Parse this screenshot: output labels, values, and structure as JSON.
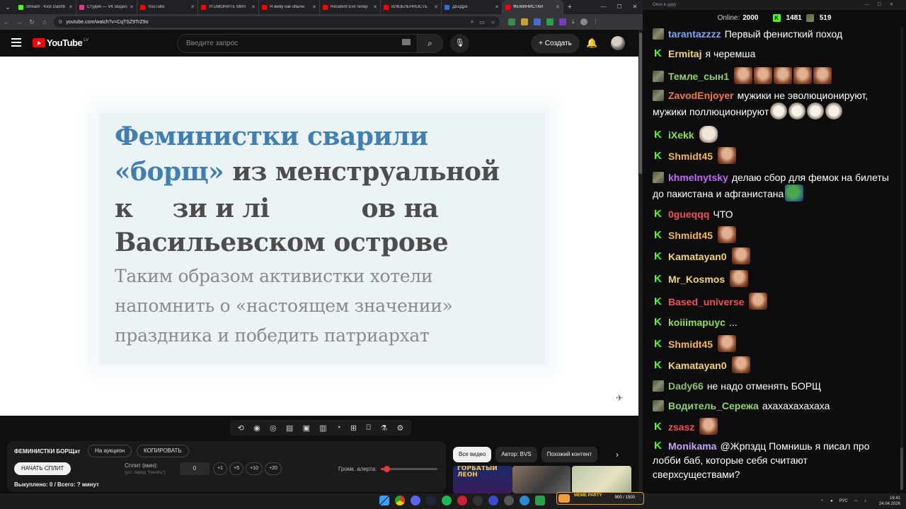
{
  "browser": {
    "tabs": [
      {
        "title": "Stream - Kick Dashb",
        "color": "#53fc18"
      },
      {
        "title": "Студия — VK Видео",
        "color": "#e23b8a"
      },
      {
        "title": "YouTube",
        "color": "#ff0000"
      },
      {
        "title": "УГОМОНИТЕ МИЛ",
        "color": "#ff0000"
      },
      {
        "title": "Я живу как обычн",
        "color": "#ff0000"
      },
      {
        "title": "Resident Evil тепер",
        "color": "#ff0000"
      },
      {
        "title": "ВЛЮБЛЕННОСТЬ",
        "color": "#ff0000"
      },
      {
        "title": "ДЕкДра",
        "color": "#3a6ad0"
      },
      {
        "title": "ФЕМИНИСТКИ",
        "color": "#ff0000"
      }
    ],
    "url": "youtube.com/watch?v=CqTSZ9TrZ9o"
  },
  "youtube": {
    "logo_text": "YouTube",
    "region": "LV",
    "search_placeholder": "Введите запрос",
    "create_label": "Создать",
    "video_slide": {
      "headline": {
        "blue": "Феминистки сварили",
        "l2_quote": "«борщ»",
        "l2_rest": "из менструальной",
        "l3a": "к",
        "l3b": "зи и лі",
        "l3c": "ов на",
        "l4": "Васильевском острове"
      },
      "sub": [
        "Таким образом активистки хотели",
        "напомнить о «настоящем значении»",
        "праздника и победить патриархат"
      ]
    },
    "chips": [
      "Все видео",
      "Автор: BVS",
      "Похожий контент"
    ],
    "thumb1_text": "ГОРБАТЫЙ ЛЕОН"
  },
  "bvs_panel": {
    "title": "ФЕМИНИСТКИ БОРЩат",
    "auction_label": "На аукцион",
    "copy_label": "КОПИРОВАТЬ",
    "start_split_label": "НАЧАТЬ СПЛИТ",
    "split_label": "Сплит (мин):",
    "split_hint": "(уст. перед \"Начать\")",
    "split_value": "0",
    "steps": [
      "+1",
      "+5",
      "+10",
      "+20"
    ],
    "volume_label": "Громк. алерта:",
    "volume_fraction": 0.1,
    "bought_text": "Выкуплено: 0 / Всего: ? минут"
  },
  "chat": {
    "window_title": "Окно в дуру",
    "online_label": "Online:",
    "online_count": "2000",
    "stat_a": "1481",
    "stat_b": "519",
    "messages": [
      {
        "badge": "s",
        "user": "tarantazzzz",
        "color": "#7fa6f5",
        "text": "Первый фенисткий поход",
        "emotes": []
      },
      {
        "badge": "k",
        "user": "Ermitaj",
        "color": "#f5d36c",
        "text": "я черемша",
        "emotes": []
      },
      {
        "badge": "s",
        "user": "Темле_сын1",
        "color": "#8fd46a",
        "text": "",
        "emotes": [
          "man",
          "man",
          "man",
          "man",
          "man"
        ]
      },
      {
        "badge": "s",
        "user": "ZavodEnjoyer",
        "color": "#f07a3c",
        "text": "мужики не эволюционируют, мужики поллюционируют",
        "emotes": [
          "hamster",
          "hamster",
          "hamster",
          "hamster"
        ]
      },
      {
        "badge": "k",
        "user": "iXekk",
        "color": "#8fe04a",
        "text": "",
        "emotes": [
          "cat"
        ]
      },
      {
        "badge": "k",
        "user": "Shmidt45",
        "color": "#f5b84a",
        "text": "",
        "emotes": [
          "man"
        ]
      },
      {
        "badge": "s",
        "user": "khmelnytsky",
        "color": "#c06af5",
        "text": "делаю сбор для фемок на билеты до пакистана и афганистана",
        "emotes": [
          "pepe"
        ]
      },
      {
        "badge": "k",
        "user": "0gueqqq",
        "color": "#f05050",
        "text": "ЧТО",
        "emotes": []
      },
      {
        "badge": "k",
        "user": "Shmidt45",
        "color": "#f5b84a",
        "text": "",
        "emotes": [
          "man"
        ]
      },
      {
        "badge": "k",
        "user": "Kamatayan0",
        "color": "#f5d36c",
        "text": "",
        "emotes": [
          "man"
        ]
      },
      {
        "badge": "k",
        "user": "Mr_Kosmos",
        "color": "#f5d36c",
        "text": "",
        "emotes": [
          "man"
        ]
      },
      {
        "badge": "k",
        "user": "Based_universe",
        "color": "#f05050",
        "text": "",
        "emotes": [
          "man"
        ]
      },
      {
        "badge": "k",
        "user": "koiiimapuyc",
        "color": "#8fe04a",
        "text": "...",
        "emotes": []
      },
      {
        "badge": "k",
        "user": "Shmidt45",
        "color": "#f5b84a",
        "text": "",
        "emotes": [
          "man"
        ]
      },
      {
        "badge": "k",
        "user": "Kamatayan0",
        "color": "#f5d36c",
        "text": "",
        "emotes": [
          "man"
        ]
      },
      {
        "badge": "s",
        "user": "Dady66",
        "color": "#8fc06a",
        "text": "не надо отменять БОРЩ",
        "emotes": []
      },
      {
        "badge": "s",
        "user": "Водитель_Сережа",
        "color": "#8fd46a",
        "text": "ахахахахахаха",
        "emotes": []
      },
      {
        "badge": "k",
        "user": "zsasz",
        "color": "#f05050",
        "text": "",
        "emotes": [
          "man"
        ]
      },
      {
        "badge": "k",
        "user": "Monikama",
        "color": "#c9a0f5",
        "text": "@Жрпздц Помнишь я писал про лобби баб, которые себя считают сверхсуществами?",
        "emotes": []
      }
    ]
  },
  "taskbar": {
    "meme_label": "MEME PARTY",
    "meme_count": "900 / 1500",
    "lang": "РУС",
    "time": "16:41",
    "date": "24.04.2026"
  }
}
